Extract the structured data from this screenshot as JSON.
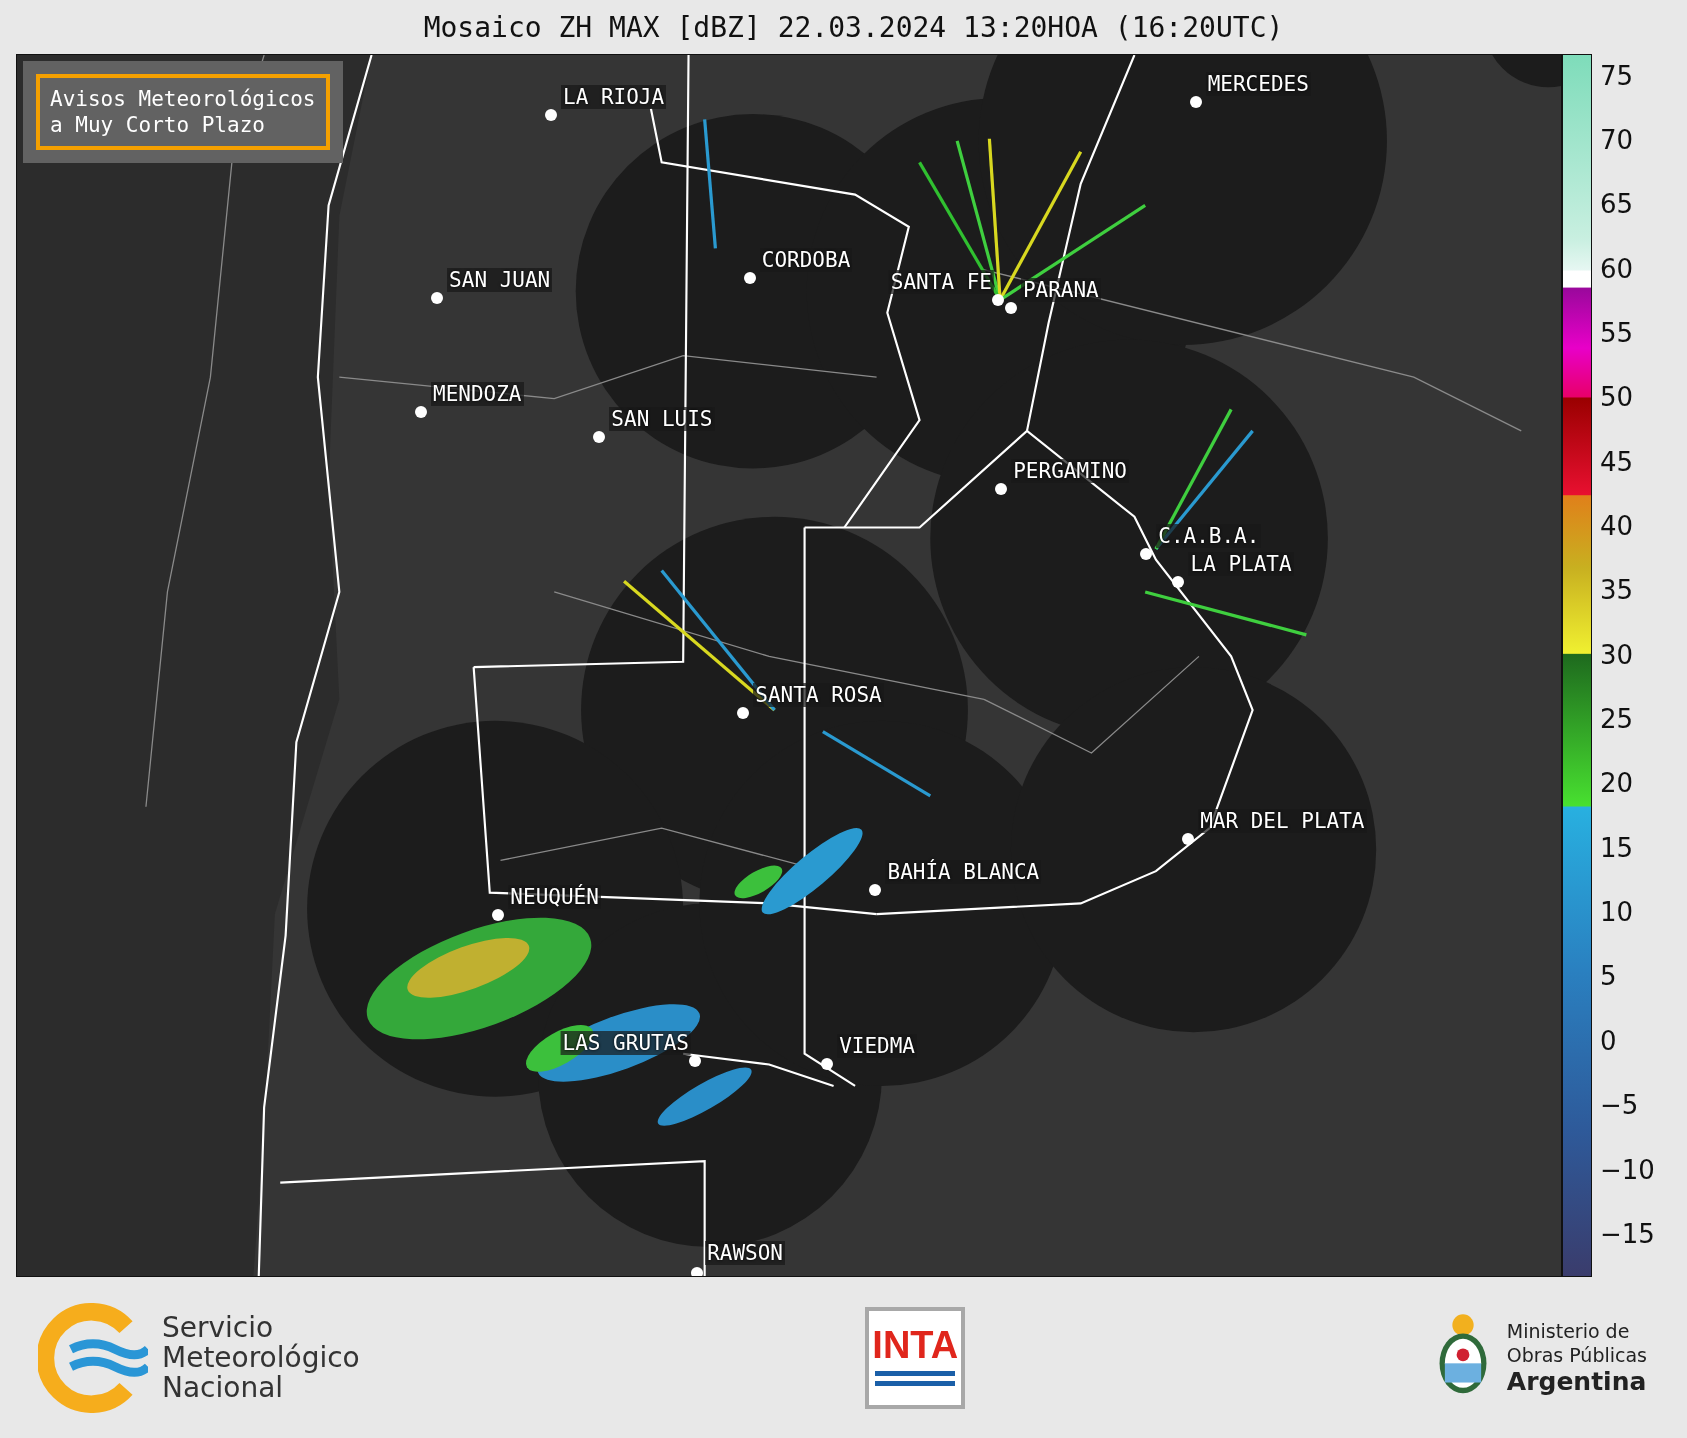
{
  "title": "Mosaico ZH MAX [dBZ] 22.03.2024 13:20HOA (16:20UTC)",
  "notice": {
    "lines": [
      "Avisos Meteorológicos",
      "a Muy Corto Plazo"
    ]
  },
  "cities": [
    {
      "name": "LA RIOJA"
    },
    {
      "name": "CORDOBA"
    },
    {
      "name": "SAN JUAN"
    },
    {
      "name": "SANTA FE"
    },
    {
      "name": "PARANA"
    },
    {
      "name": "MENDOZA"
    },
    {
      "name": "SAN LUIS"
    },
    {
      "name": "MERCEDES"
    },
    {
      "name": "PERGAMINO"
    },
    {
      "name": "C.A.B.A."
    },
    {
      "name": "LA PLATA"
    },
    {
      "name": "SANTA ROSA"
    },
    {
      "name": "MAR DEL PLATA"
    },
    {
      "name": "BAHÍA BLANCA"
    },
    {
      "name": "NEUQUÉN"
    },
    {
      "name": "LAS GRUTAS"
    },
    {
      "name": "VIEDMA"
    },
    {
      "name": "RAWSON"
    }
  ],
  "colorbar": {
    "ticks": [
      "75",
      "70",
      "65",
      "60",
      "55",
      "50",
      "45",
      "40",
      "35",
      "30",
      "25",
      "20",
      "15",
      "10",
      "5",
      "0",
      "−5",
      "−10",
      "−15"
    ]
  },
  "footer": {
    "smn": [
      "Servicio",
      "Meteorológico",
      "Nacional"
    ],
    "inta": "INTA",
    "ministry": [
      "Ministerio de",
      "Obras Públicas",
      "Argentina"
    ]
  }
}
